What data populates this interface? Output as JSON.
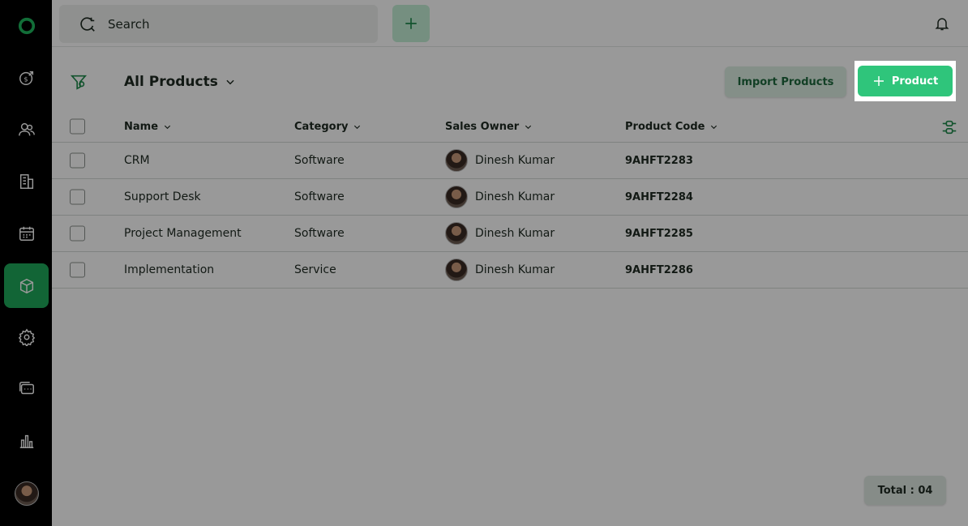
{
  "colors": {
    "brand": "#2fc57b",
    "sidebar": "#000000",
    "active_nav": "#1fa85a"
  },
  "sidebar": {
    "items": [
      {
        "icon": "logo-icon"
      },
      {
        "icon": "deals-icon"
      },
      {
        "icon": "contacts-icon"
      },
      {
        "icon": "companies-icon"
      },
      {
        "icon": "calendar-icon"
      },
      {
        "icon": "products-icon",
        "active": true
      },
      {
        "icon": "settings-icon"
      },
      {
        "icon": "chat-icon"
      },
      {
        "icon": "reports-icon"
      },
      {
        "icon": "user-avatar"
      }
    ]
  },
  "topbar": {
    "search_label": "Search",
    "add_icon": "plus-icon",
    "bell_icon": "bell-icon"
  },
  "header": {
    "view_title": "All Products",
    "import_label": "Import Products",
    "product_label": "Product"
  },
  "table": {
    "columns": [
      "Name",
      "Category",
      "Sales Owner",
      "Product Code"
    ],
    "rows": [
      {
        "name": "CRM",
        "category": "Software",
        "owner": "Dinesh Kumar",
        "code": "9AHFT2283"
      },
      {
        "name": "Support Desk",
        "category": "Software",
        "owner": "Dinesh Kumar",
        "code": "9AHFT2284"
      },
      {
        "name": "Project Management",
        "category": "Software",
        "owner": "Dinesh Kumar",
        "code": "9AHFT2285"
      },
      {
        "name": "Implementation",
        "category": "Service",
        "owner": "Dinesh Kumar",
        "code": "9AHFT2286"
      }
    ]
  },
  "footer": {
    "total_label": "Total : 04"
  }
}
